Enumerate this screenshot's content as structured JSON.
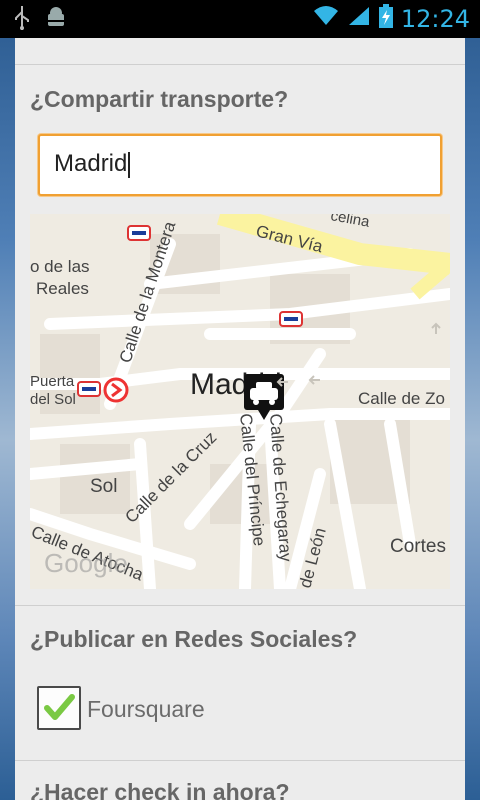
{
  "status_bar": {
    "time": "12:24",
    "icons": [
      "usb-icon",
      "android-debug-icon",
      "wifi-icon",
      "signal-icon",
      "battery-charging-icon"
    ],
    "accent_color": "#33b5e5"
  },
  "form": {
    "transport_section": {
      "title": "¿Compartir transporte?",
      "city_input_value": "Madrid",
      "input_focus_color": "#f0a032"
    },
    "map": {
      "center_label": "Madrid",
      "attribution": "Google",
      "labels": [
        "Gran Vía",
        "Calle de la Montera",
        "o de las",
        "Reales",
        "Puerta",
        "del Sol",
        "Calle de Zo",
        "Calle de la Cruz",
        "Calle del Príncipe",
        "Calle de Echegaray",
        "Sol",
        "Calle de Atocha",
        "de León",
        "Cortes",
        "celina"
      ],
      "marker_icon": "taxi-marker-icon"
    },
    "social_section": {
      "title": "¿Publicar en Redes Sociales?",
      "options": [
        {
          "label": "Foursquare",
          "checked": true
        }
      ]
    },
    "checkin_section": {
      "title": "¿Hacer check in ahora?"
    }
  }
}
